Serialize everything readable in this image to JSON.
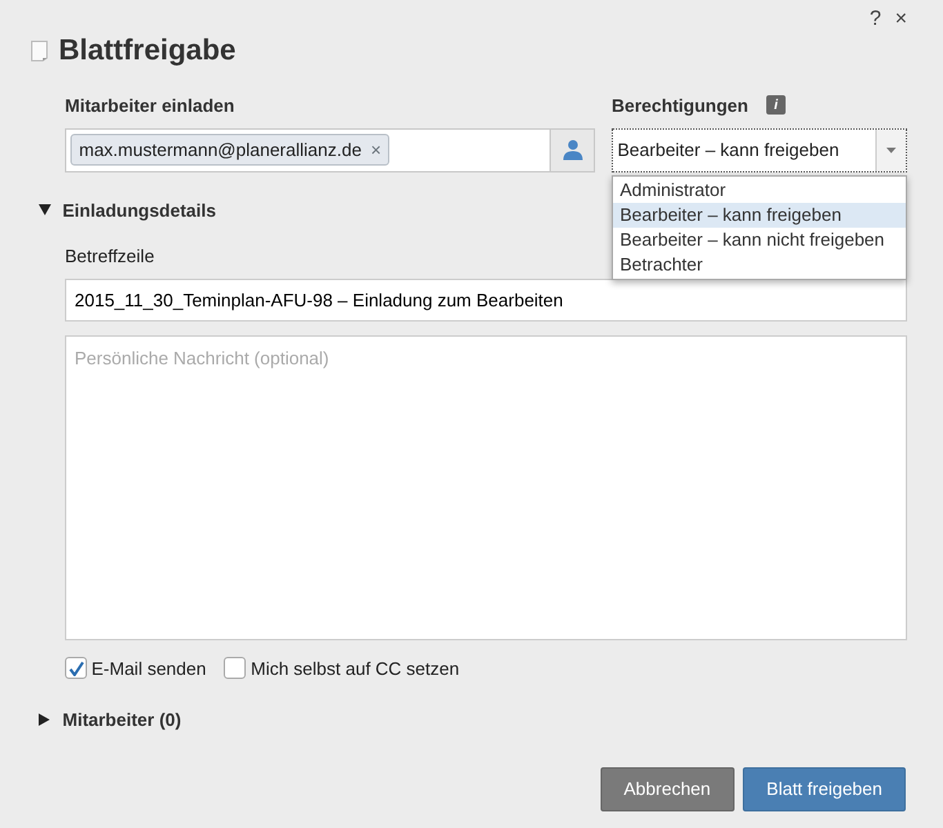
{
  "window": {
    "title": "Blattfreigabe",
    "help": "?",
    "close": "×"
  },
  "invite": {
    "label": "Mitarbeiter einladen",
    "tokens": [
      {
        "text": "max.mustermann@planerallianz.de",
        "remove": "×"
      }
    ]
  },
  "permissions": {
    "label": "Berechtigungen",
    "info": "i",
    "value": "Bearbeiter – kann freigeben",
    "expanded": true,
    "options": [
      {
        "label": "Administrator",
        "selected": false
      },
      {
        "label": "Bearbeiter – kann freigeben",
        "selected": true
      },
      {
        "label": "Bearbeiter – kann nicht freigeben",
        "selected": false
      },
      {
        "label": "Betrachter",
        "selected": false
      }
    ]
  },
  "details": {
    "label": "Einladungsdetails",
    "expanded": true,
    "subject_label": "Betreffzeile",
    "subject": "2015_11_30_Teminplan-AFU-98 – Einladung zum Bearbeiten",
    "message_placeholder": "Persönliche Nachricht (optional)",
    "checkboxes": [
      {
        "label": "E-Mail senden",
        "checked": true
      },
      {
        "label": "Mich selbst auf CC setzen",
        "checked": false
      }
    ]
  },
  "collaborators": {
    "label": "Mitarbeiter (0)",
    "expanded": false
  },
  "buttons": [
    {
      "label": "Abbrechen",
      "kind": "secondary"
    },
    {
      "label": "Blatt freigeben",
      "kind": "primary"
    }
  ]
}
